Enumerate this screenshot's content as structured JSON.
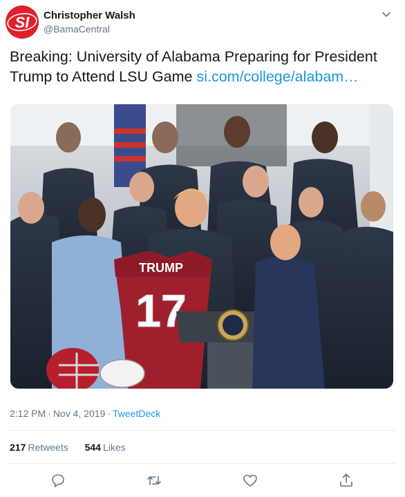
{
  "author": {
    "name": "Christopher Walsh",
    "handle": "@BamaCentral",
    "avatar_logo": "SI",
    "avatar_color": "#e0202b"
  },
  "tweet": {
    "text": "Breaking: University of Alabama Preparing for President Trump to Attend LSU Game ",
    "link": "si.com/college/alabam…"
  },
  "media": {
    "jersey_name": "TRUMP",
    "jersey_number": "17",
    "jersey_color": "#a01f2d"
  },
  "meta": {
    "time": "2:12 PM",
    "date": "Nov 4, 2019",
    "separator": "·",
    "source": "TweetDeck"
  },
  "stats": {
    "retweets_count": "217",
    "retweets_label": "Retweets",
    "likes_count": "544",
    "likes_label": "Likes"
  },
  "actions": [
    "reply-icon",
    "retweet-icon",
    "like-icon",
    "share-icon"
  ],
  "colors": {
    "link": "#1b95e0",
    "muted": "#657786",
    "text": "#14171a"
  }
}
